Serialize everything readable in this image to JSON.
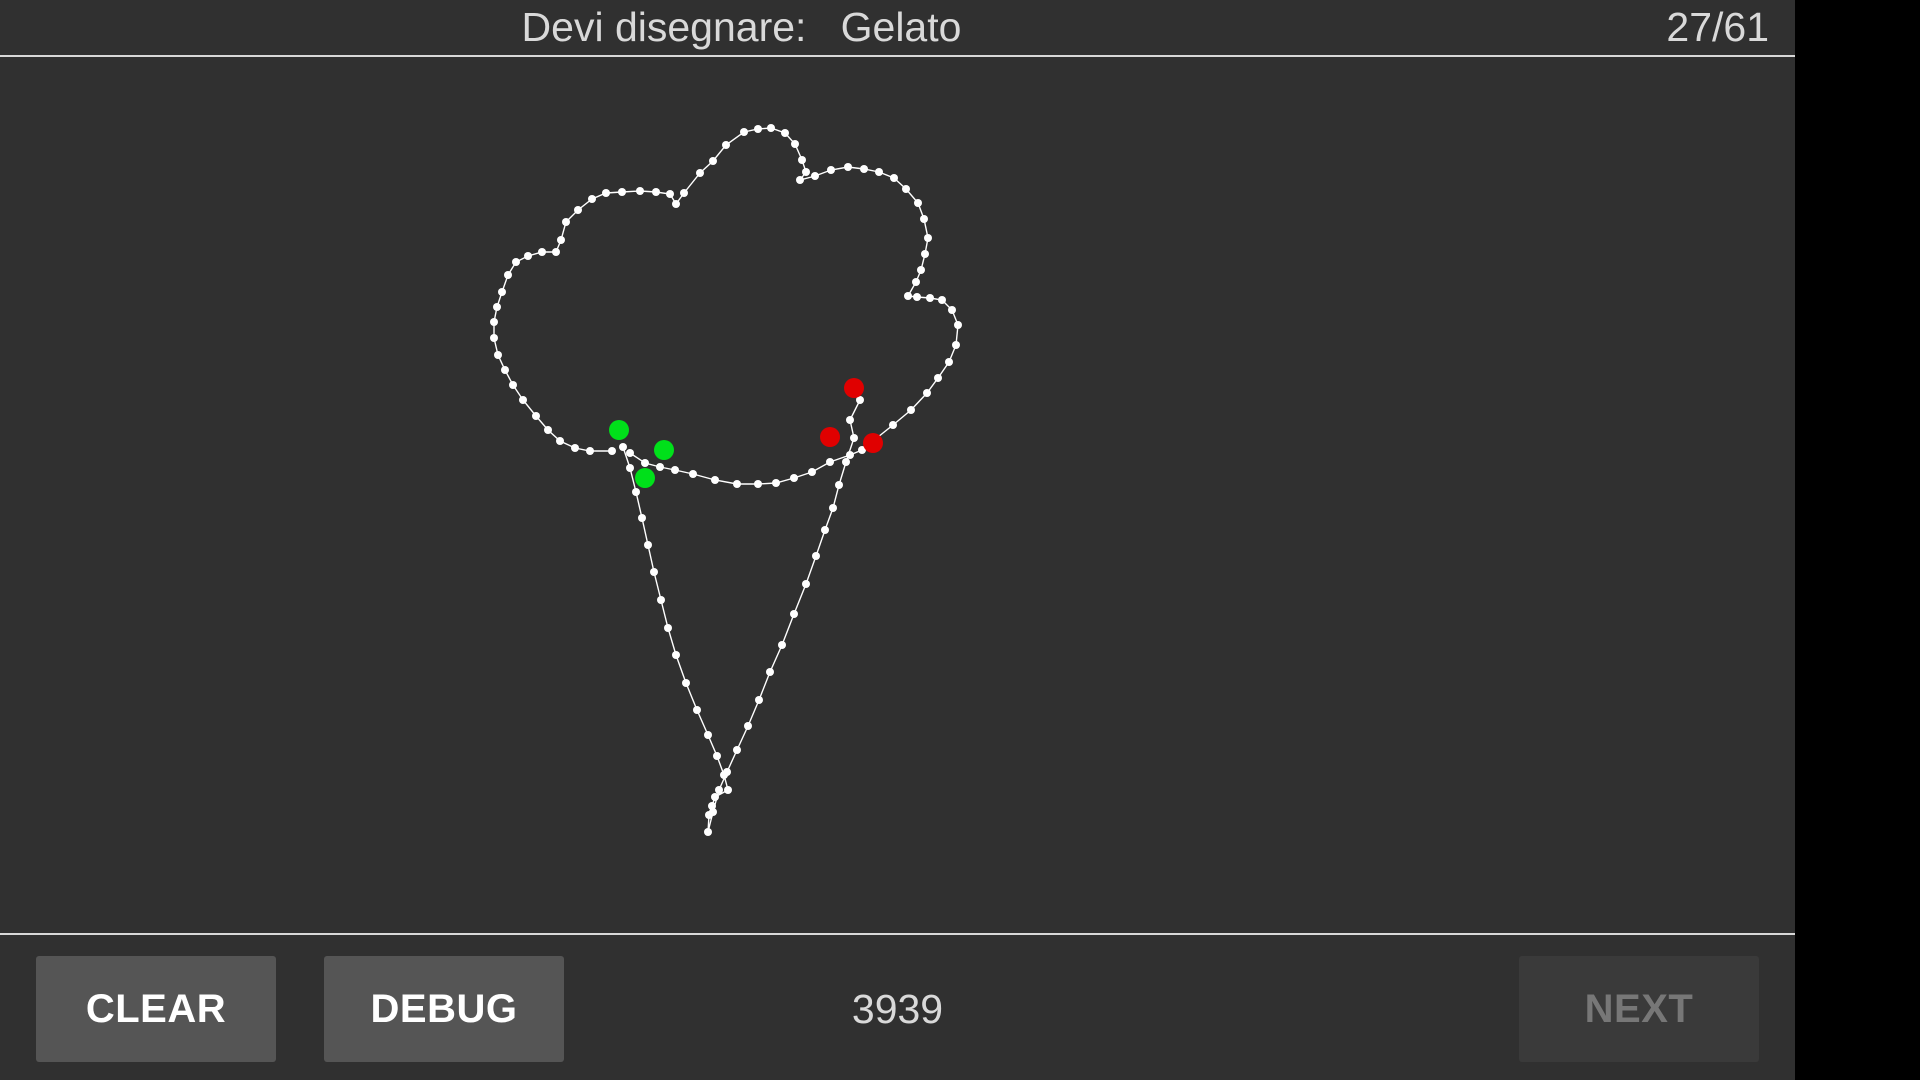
{
  "header": {
    "prompt_label": "Devi disegnare:",
    "prompt_word": "Gelato",
    "progress": "27/61"
  },
  "footer": {
    "clear_label": "CLEAR",
    "debug_label": "DEBUG",
    "score": "3939",
    "next_label": "NEXT"
  },
  "colors": {
    "background": "#303030",
    "stroke": "#ffffff",
    "correct_marker": "#00e01a",
    "wrong_marker": "#e00000"
  },
  "drawing": {
    "subject": "ice-cream-cone",
    "correct_marker_count": 3,
    "wrong_marker_count": 3
  }
}
